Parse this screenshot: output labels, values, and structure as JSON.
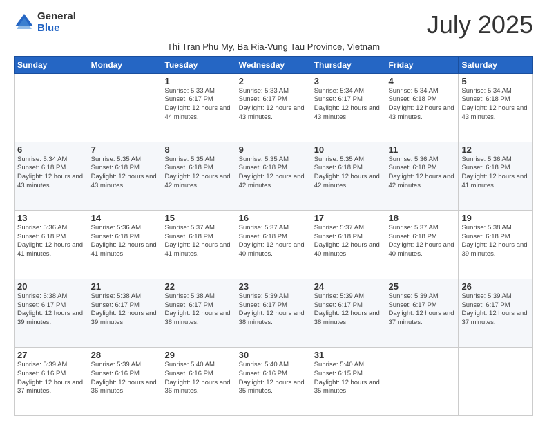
{
  "logo": {
    "general": "General",
    "blue": "Blue"
  },
  "header": {
    "month": "July 2025",
    "subtitle": "Thi Tran Phu My, Ba Ria-Vung Tau Province, Vietnam"
  },
  "days_of_week": [
    "Sunday",
    "Monday",
    "Tuesday",
    "Wednesday",
    "Thursday",
    "Friday",
    "Saturday"
  ],
  "weeks": [
    [
      {
        "day": "",
        "info": ""
      },
      {
        "day": "",
        "info": ""
      },
      {
        "day": "1",
        "info": "Sunrise: 5:33 AM\nSunset: 6:17 PM\nDaylight: 12 hours and 44 minutes."
      },
      {
        "day": "2",
        "info": "Sunrise: 5:33 AM\nSunset: 6:17 PM\nDaylight: 12 hours and 43 minutes."
      },
      {
        "day": "3",
        "info": "Sunrise: 5:34 AM\nSunset: 6:17 PM\nDaylight: 12 hours and 43 minutes."
      },
      {
        "day": "4",
        "info": "Sunrise: 5:34 AM\nSunset: 6:18 PM\nDaylight: 12 hours and 43 minutes."
      },
      {
        "day": "5",
        "info": "Sunrise: 5:34 AM\nSunset: 6:18 PM\nDaylight: 12 hours and 43 minutes."
      }
    ],
    [
      {
        "day": "6",
        "info": "Sunrise: 5:34 AM\nSunset: 6:18 PM\nDaylight: 12 hours and 43 minutes."
      },
      {
        "day": "7",
        "info": "Sunrise: 5:35 AM\nSunset: 6:18 PM\nDaylight: 12 hours and 43 minutes."
      },
      {
        "day": "8",
        "info": "Sunrise: 5:35 AM\nSunset: 6:18 PM\nDaylight: 12 hours and 42 minutes."
      },
      {
        "day": "9",
        "info": "Sunrise: 5:35 AM\nSunset: 6:18 PM\nDaylight: 12 hours and 42 minutes."
      },
      {
        "day": "10",
        "info": "Sunrise: 5:35 AM\nSunset: 6:18 PM\nDaylight: 12 hours and 42 minutes."
      },
      {
        "day": "11",
        "info": "Sunrise: 5:36 AM\nSunset: 6:18 PM\nDaylight: 12 hours and 42 minutes."
      },
      {
        "day": "12",
        "info": "Sunrise: 5:36 AM\nSunset: 6:18 PM\nDaylight: 12 hours and 41 minutes."
      }
    ],
    [
      {
        "day": "13",
        "info": "Sunrise: 5:36 AM\nSunset: 6:18 PM\nDaylight: 12 hours and 41 minutes."
      },
      {
        "day": "14",
        "info": "Sunrise: 5:36 AM\nSunset: 6:18 PM\nDaylight: 12 hours and 41 minutes."
      },
      {
        "day": "15",
        "info": "Sunrise: 5:37 AM\nSunset: 6:18 PM\nDaylight: 12 hours and 41 minutes."
      },
      {
        "day": "16",
        "info": "Sunrise: 5:37 AM\nSunset: 6:18 PM\nDaylight: 12 hours and 40 minutes."
      },
      {
        "day": "17",
        "info": "Sunrise: 5:37 AM\nSunset: 6:18 PM\nDaylight: 12 hours and 40 minutes."
      },
      {
        "day": "18",
        "info": "Sunrise: 5:37 AM\nSunset: 6:18 PM\nDaylight: 12 hours and 40 minutes."
      },
      {
        "day": "19",
        "info": "Sunrise: 5:38 AM\nSunset: 6:18 PM\nDaylight: 12 hours and 39 minutes."
      }
    ],
    [
      {
        "day": "20",
        "info": "Sunrise: 5:38 AM\nSunset: 6:17 PM\nDaylight: 12 hours and 39 minutes."
      },
      {
        "day": "21",
        "info": "Sunrise: 5:38 AM\nSunset: 6:17 PM\nDaylight: 12 hours and 39 minutes."
      },
      {
        "day": "22",
        "info": "Sunrise: 5:38 AM\nSunset: 6:17 PM\nDaylight: 12 hours and 38 minutes."
      },
      {
        "day": "23",
        "info": "Sunrise: 5:39 AM\nSunset: 6:17 PM\nDaylight: 12 hours and 38 minutes."
      },
      {
        "day": "24",
        "info": "Sunrise: 5:39 AM\nSunset: 6:17 PM\nDaylight: 12 hours and 38 minutes."
      },
      {
        "day": "25",
        "info": "Sunrise: 5:39 AM\nSunset: 6:17 PM\nDaylight: 12 hours and 37 minutes."
      },
      {
        "day": "26",
        "info": "Sunrise: 5:39 AM\nSunset: 6:17 PM\nDaylight: 12 hours and 37 minutes."
      }
    ],
    [
      {
        "day": "27",
        "info": "Sunrise: 5:39 AM\nSunset: 6:16 PM\nDaylight: 12 hours and 37 minutes."
      },
      {
        "day": "28",
        "info": "Sunrise: 5:39 AM\nSunset: 6:16 PM\nDaylight: 12 hours and 36 minutes."
      },
      {
        "day": "29",
        "info": "Sunrise: 5:40 AM\nSunset: 6:16 PM\nDaylight: 12 hours and 36 minutes."
      },
      {
        "day": "30",
        "info": "Sunrise: 5:40 AM\nSunset: 6:16 PM\nDaylight: 12 hours and 35 minutes."
      },
      {
        "day": "31",
        "info": "Sunrise: 5:40 AM\nSunset: 6:15 PM\nDaylight: 12 hours and 35 minutes."
      },
      {
        "day": "",
        "info": ""
      },
      {
        "day": "",
        "info": ""
      }
    ]
  ]
}
